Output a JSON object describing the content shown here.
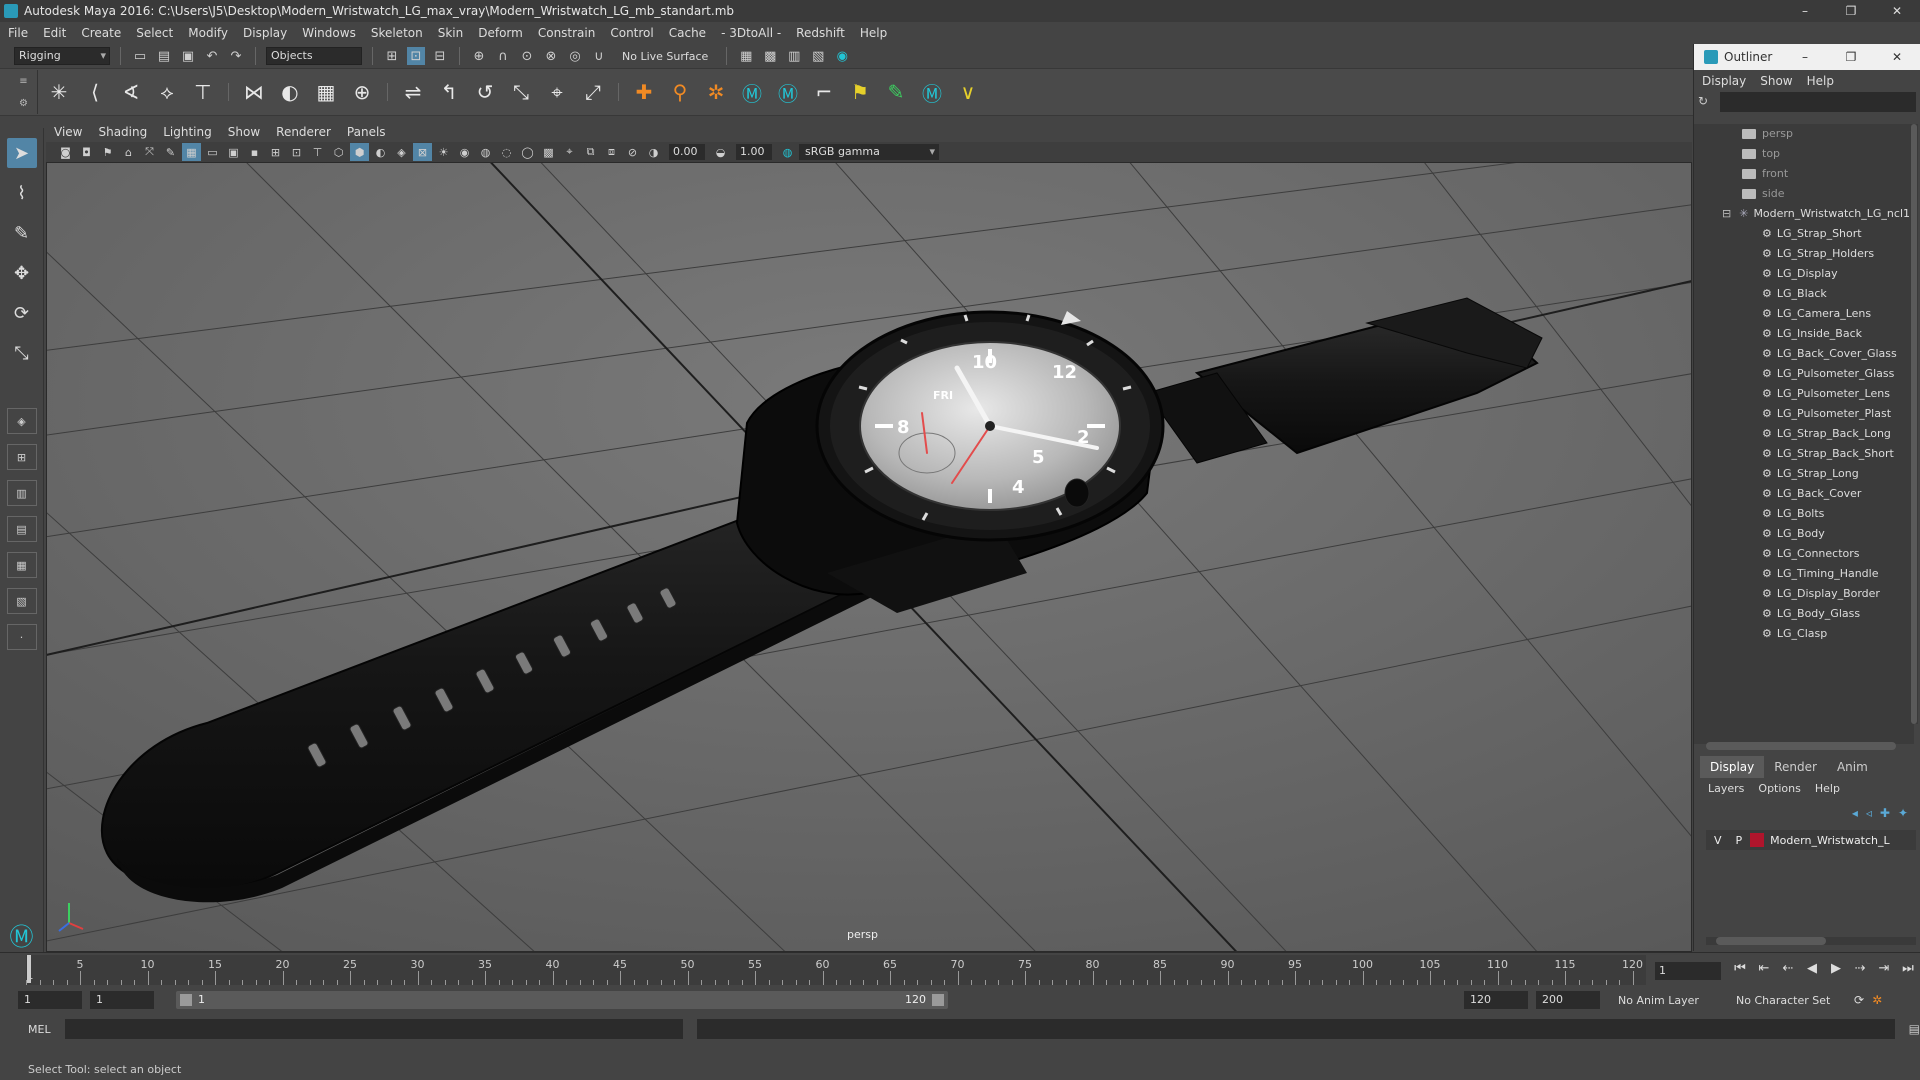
{
  "window": {
    "title": "Autodesk Maya 2016: C:\\Users\\J5\\Desktop\\Modern_Wristwatch_LG_max_vray\\Modern_Wristwatch_LG_mb_standart.mb",
    "minimize": "–",
    "maximize": "❐",
    "close": "✕"
  },
  "menubar": [
    "File",
    "Edit",
    "Create",
    "Select",
    "Modify",
    "Display",
    "Windows",
    "Skeleton",
    "Skin",
    "Deform",
    "Constrain",
    "Control",
    "Cache",
    "- 3DtoAll -",
    "Redshift",
    "Help"
  ],
  "statusline": {
    "mode": "Rigging",
    "selection_mask": "Objects",
    "live_surface": "No Live Surface"
  },
  "viewport": {
    "menu": [
      "View",
      "Shading",
      "Lighting",
      "Show",
      "Renderer",
      "Panels"
    ],
    "exposure": "0.00",
    "gamma_value": "1.00",
    "color_space": "sRGB gamma",
    "camera_label": "persp",
    "watch_numerals": [
      "10",
      "12",
      "2",
      "4",
      "5",
      "8",
      "FRI"
    ]
  },
  "outliner": {
    "title": "Outliner",
    "menu": [
      "Display",
      "Show",
      "Help"
    ],
    "cameras": [
      "persp",
      "top",
      "front",
      "side"
    ],
    "root": "Modern_Wristwatch_LG_ncl1",
    "children": [
      "LG_Strap_Short",
      "LG_Strap_Holders",
      "LG_Display",
      "LG_Black",
      "LG_Camera_Lens",
      "LG_Inside_Back",
      "LG_Back_Cover_Glass",
      "LG_Pulsometer_Glass",
      "LG_Pulsometer_Lens",
      "LG_Pulsometer_Plast",
      "LG_Strap_Back_Long",
      "LG_Strap_Back_Short",
      "LG_Strap_Long",
      "LG_Back_Cover",
      "LG_Bolts",
      "LG_Body",
      "LG_Connectors",
      "LG_Timing_Handle",
      "LG_Display_Border",
      "LG_Body_Glass",
      "LG_Clasp"
    ]
  },
  "layers": {
    "tabs": [
      "Display",
      "Render",
      "Anim"
    ],
    "menu": [
      "Layers",
      "Options",
      "Help"
    ],
    "row": {
      "v": "V",
      "p": "P",
      "name": "Modern_Wristwatch_L",
      "color": "#b0152c"
    }
  },
  "timeline": {
    "ticks": [
      5,
      10,
      15,
      20,
      25,
      30,
      35,
      40,
      45,
      50,
      55,
      60,
      65,
      70,
      75,
      80,
      85,
      90,
      95,
      100,
      105,
      110,
      115,
      120
    ],
    "first_label": "1",
    "current_frame": "1"
  },
  "range": {
    "start": "1",
    "playback_start": "1",
    "inner_start": "1",
    "inner_end": "120",
    "playback_end": "120",
    "end": "200",
    "anim_layer": "No Anim Layer",
    "character_set": "No Character Set"
  },
  "cmdline": {
    "lang": "MEL"
  },
  "helpline": "Select Tool: select an object"
}
